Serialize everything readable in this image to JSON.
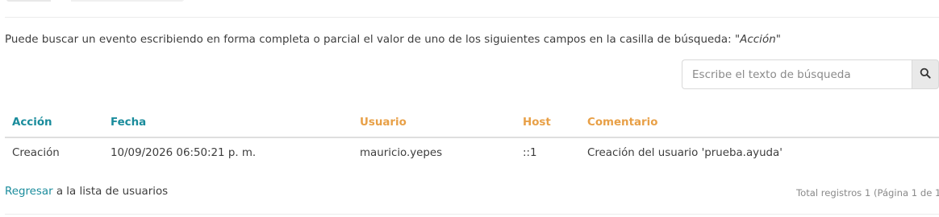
{
  "instructions": {
    "text": "Puede buscar un evento escribiendo en forma completa o parcial el valor de uno de los siguientes campos en la casilla de búsqueda: ",
    "field": "\"Acción\""
  },
  "search": {
    "placeholder": "Escribe el texto de búsqueda",
    "icon": "search-icon"
  },
  "table": {
    "headers": {
      "accion": "Acción",
      "fecha": "Fecha",
      "usuario": "Usuario",
      "host": "Host",
      "comentario": "Comentario"
    },
    "rows": [
      {
        "accion": "Creación",
        "fecha": "10/09/2026 06:50:21 p. m.",
        "usuario": "mauricio.yepes",
        "host": "::1",
        "comentario": "Creación del usuario 'prueba.ayuda'"
      }
    ]
  },
  "footer": {
    "back_link": "Regresar",
    "back_text": " a la lista de usuarios",
    "total": "Total registros 1 (Página 1 de 1"
  },
  "colors": {
    "accent_teal": "#1a8c9c",
    "accent_orange": "#e8a047"
  }
}
